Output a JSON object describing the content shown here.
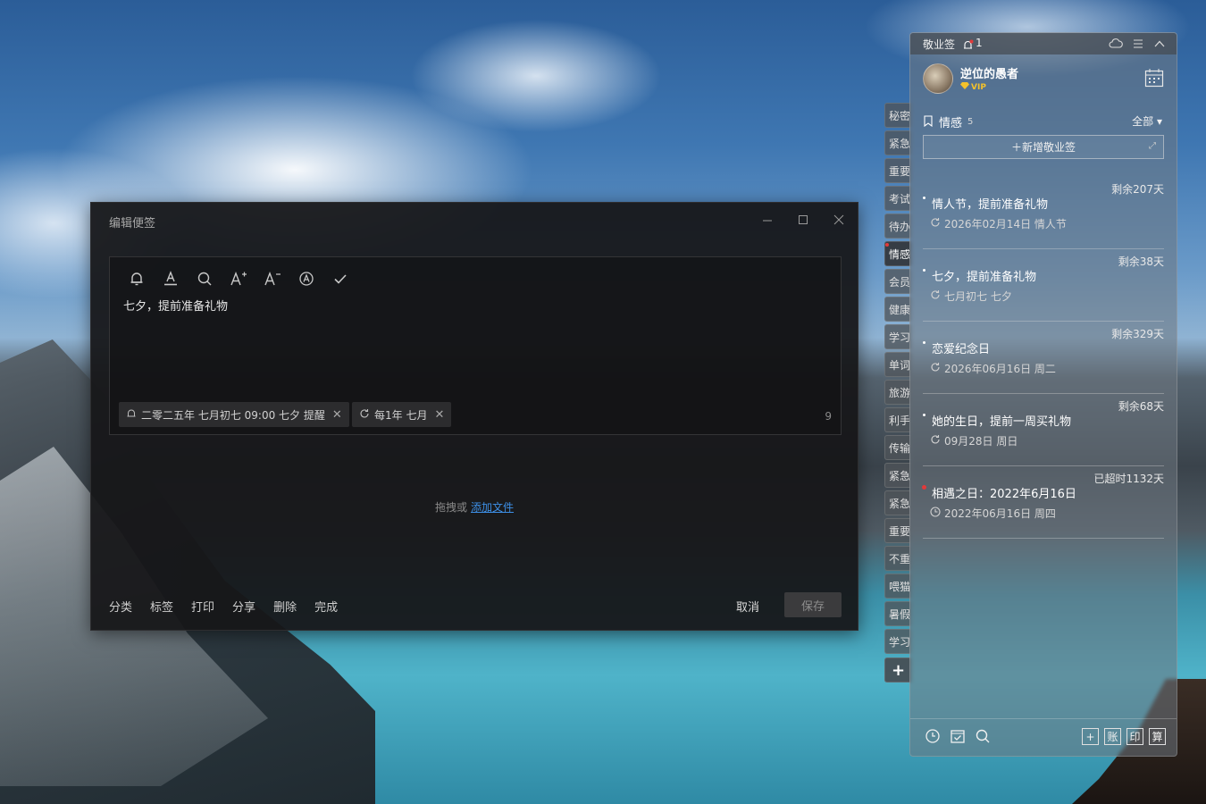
{
  "dialog": {
    "title": "编辑便签",
    "content_text": "七夕，提前准备礼物",
    "reminder_tag": "二零二五年 七月初七 09:00 七夕 提醒",
    "repeat_tag": "每1年 七月",
    "char_count": "9",
    "drop_text": "拖拽或",
    "drop_link": "添加文件",
    "actions": [
      "分类",
      "标签",
      "打印",
      "分享",
      "删除",
      "完成"
    ],
    "cancel": "取消",
    "save": "保存"
  },
  "side_tabs": [
    "秘密",
    "紧急",
    "重要",
    "考试",
    "待办",
    "情感",
    "会员",
    "健康",
    "学习",
    "单词",
    "旅游",
    "利手",
    "传输",
    "紧急",
    "紧急",
    "重要",
    "不重",
    "喂猫",
    "暑假",
    "学习"
  ],
  "active_tab_index": 5,
  "panel": {
    "app_name": "敬业签",
    "notif_count": "1",
    "username": "逆位的愚者",
    "vip_label": "VIP",
    "category": "情感",
    "category_count": "5",
    "filter": "全部",
    "add_note": "新增敬业签",
    "notes": [
      {
        "remain": "剩余207天",
        "title": "情人节，提前准备礼物",
        "meta": "2026年02月14日 情人节",
        "meta_icon": "repeat-icon",
        "overdue": false
      },
      {
        "remain": "剩余38天",
        "title": "七夕，提前准备礼物",
        "meta": "七月初七 七夕",
        "meta_icon": "repeat-icon",
        "overdue": false
      },
      {
        "remain": "剩余329天",
        "title": "恋爱纪念日",
        "meta": "2026年06月16日 周二",
        "meta_icon": "repeat-icon",
        "overdue": false
      },
      {
        "remain": "剩余68天",
        "title": "她的生日，提前一周买礼物",
        "meta": "09月28日 周日",
        "meta_icon": "repeat-icon",
        "overdue": false
      },
      {
        "remain": "已超时1132天",
        "title": "相遇之日：2022年6月16日",
        "meta": "2022年06月16日 周四",
        "meta_icon": "clock-icon",
        "overdue": true
      }
    ],
    "bottom_buttons": [
      "账",
      "印",
      "算"
    ]
  },
  "colors": {
    "accent_link": "#3d8fe6",
    "overdue_dot": "#e23a3a",
    "vip": "#f4c22b"
  }
}
